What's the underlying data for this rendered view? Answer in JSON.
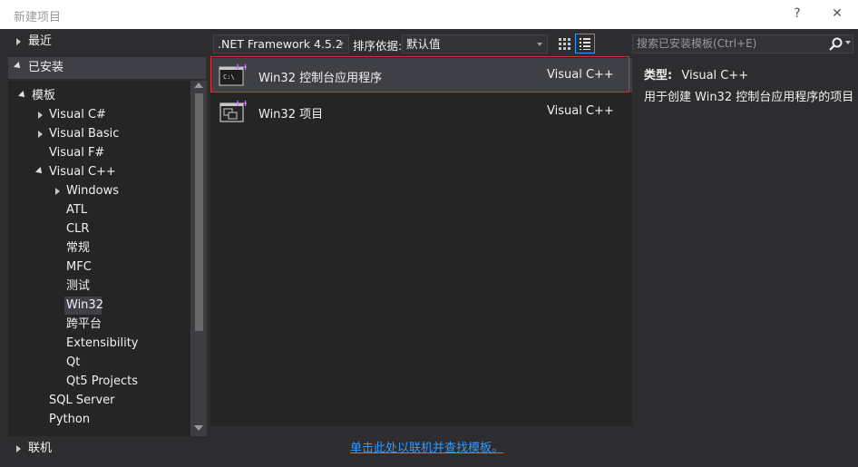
{
  "window": {
    "title": "新建项目",
    "help": "?",
    "close": "✕"
  },
  "tree": {
    "recent": "最近",
    "installed": "已安装",
    "templates": "模板",
    "items": [
      "Visual C#",
      "Visual Basic",
      "Visual F#",
      "Visual C++",
      "Windows",
      "ATL",
      "CLR",
      "常规",
      "MFC",
      "测试",
      "Win32",
      "跨平台",
      "Extensibility",
      "Qt",
      "Qt5 Projects",
      "SQL Server",
      "Python"
    ],
    "online": "联机",
    "selected": "Win32"
  },
  "toolbar": {
    "framework": ".NET Framework 4.5.2",
    "sort_label": "排序依据:",
    "sort_value": "默认值",
    "search_placeholder": "搜索已安装模板(Ctrl+E)"
  },
  "templates": [
    {
      "name": "Win32 控制台应用程序",
      "language": "Visual C++",
      "icon": "console-app-icon",
      "selected": true
    },
    {
      "name": "Win32 项目",
      "language": "Visual C++",
      "icon": "win32-project-icon",
      "selected": false
    }
  ],
  "description": {
    "type_label": "类型:",
    "type_value": "Visual C++",
    "text": "用于创建 Win32 控制台应用程序的项目"
  },
  "footer": {
    "online_link": "单击此处以联机并查找模板。"
  },
  "colors": {
    "background": "#2d2d30",
    "panel": "#252526",
    "selection": "#3f3f46",
    "accent": "#3399ff",
    "highlight_border": "#d33333"
  }
}
